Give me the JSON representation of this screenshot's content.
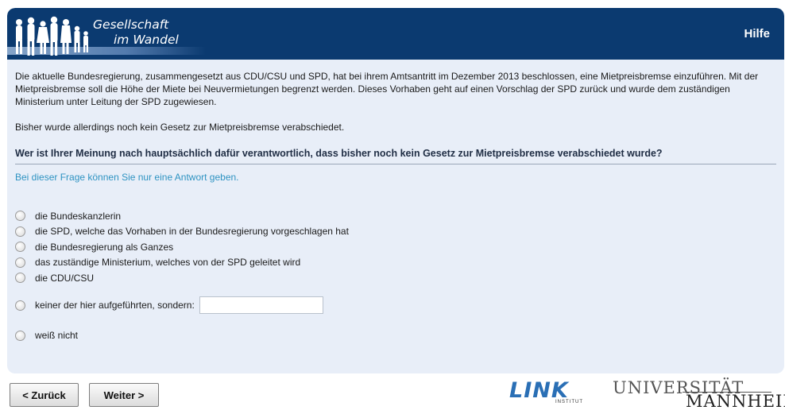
{
  "header": {
    "logo_line1": "Gesellschaft",
    "logo_line2": "im Wandel",
    "help_label": "Hilfe",
    "colors": {
      "header_bg": "#0b3a70",
      "panel_bg": "#e8eef8",
      "hint": "#2e93c2"
    },
    "logo_icon": "people-silhouettes-icon"
  },
  "intro": {
    "paragraph1": "Die aktuelle Bundesregierung, zusammengesetzt aus CDU/CSU und SPD, hat bei ihrem Amtsantritt im Dezember 2013 beschlossen, eine Mietpreisbremse einzuführen. Mit der Mietpreisbremse soll die Höhe der Miete bei Neuvermietungen begrenzt werden. Dieses Vorhaben geht auf einen Vorschlag der SPD zurück und wurde dem zuständigen Ministerium unter Leitung der SPD zugewiesen.",
    "paragraph2": "Bisher wurde allerdings noch kein Gesetz zur Mietpreisbremse verabschiedet."
  },
  "question": {
    "text": "Wer ist Ihrer Meinung nach hauptsächlich dafür verantwortlich, dass bisher noch kein Gesetz zur Mietpreisbremse verabschiedet wurde?",
    "hint": "Bei dieser Frage können Sie nur eine Antwort geben."
  },
  "options": [
    {
      "label": "die Bundeskanzlerin"
    },
    {
      "label": "die SPD, welche das Vorhaben in der Bundesregierung vorgeschlagen hat"
    },
    {
      "label": "die Bundesregierung als Ganzes"
    },
    {
      "label": "das zuständige Ministerium, welches von der SPD geleitet wird"
    },
    {
      "label": "die CDU/CSU"
    }
  ],
  "other_option": {
    "label": "keiner der hier aufgeführten, sondern:",
    "value": ""
  },
  "dont_know": {
    "label": "weiß nicht"
  },
  "navigation": {
    "back_label": "< Zurück",
    "next_label": "Weiter >"
  },
  "footer": {
    "link_logo": "LINK",
    "link_sub": "INSTITUT",
    "uni_line1": "UNIVERSITÄT",
    "uni_line2": "MANNHEIM"
  }
}
